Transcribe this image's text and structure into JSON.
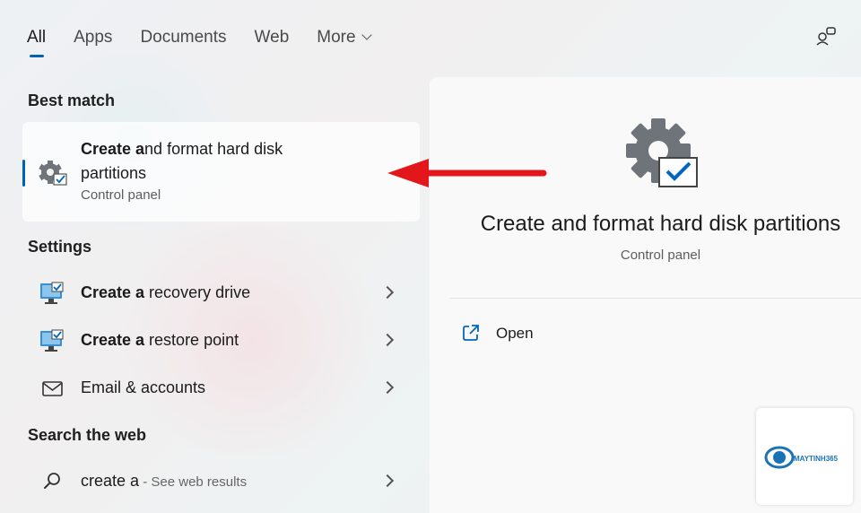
{
  "tabs": [
    {
      "label": "All",
      "active": true
    },
    {
      "label": "Apps"
    },
    {
      "label": "Documents"
    },
    {
      "label": "Web"
    },
    {
      "label": "More"
    }
  ],
  "sections": {
    "best_match": "Best match",
    "settings": "Settings",
    "search_web": "Search the web"
  },
  "best_match": {
    "title_bold": "Create a",
    "title_rest": "nd format hard disk partitions",
    "subtitle": "Control panel",
    "icon": "gear-checkbox-icon"
  },
  "settings_items": [
    {
      "bold": "Create a",
      "rest": " recovery drive",
      "icon": "monitor-check-icon"
    },
    {
      "bold": "Create a",
      "rest": " restore point",
      "icon": "monitor-check-icon"
    },
    {
      "bold": "",
      "rest": "Email & accounts",
      "icon": "mail-icon"
    }
  ],
  "web_search": {
    "query": "create a",
    "suffix": " - See web results",
    "icon": "search-icon"
  },
  "detail": {
    "title": "Create and format hard disk partitions",
    "subtitle": "Control panel",
    "action_label": "Open",
    "action_icon": "open-external-icon"
  },
  "watermark": {
    "text": "MAYTINH365"
  },
  "colors": {
    "accent": "#0063b1",
    "arrow": "#e3161b",
    "icon_blue": "#0067c0"
  }
}
